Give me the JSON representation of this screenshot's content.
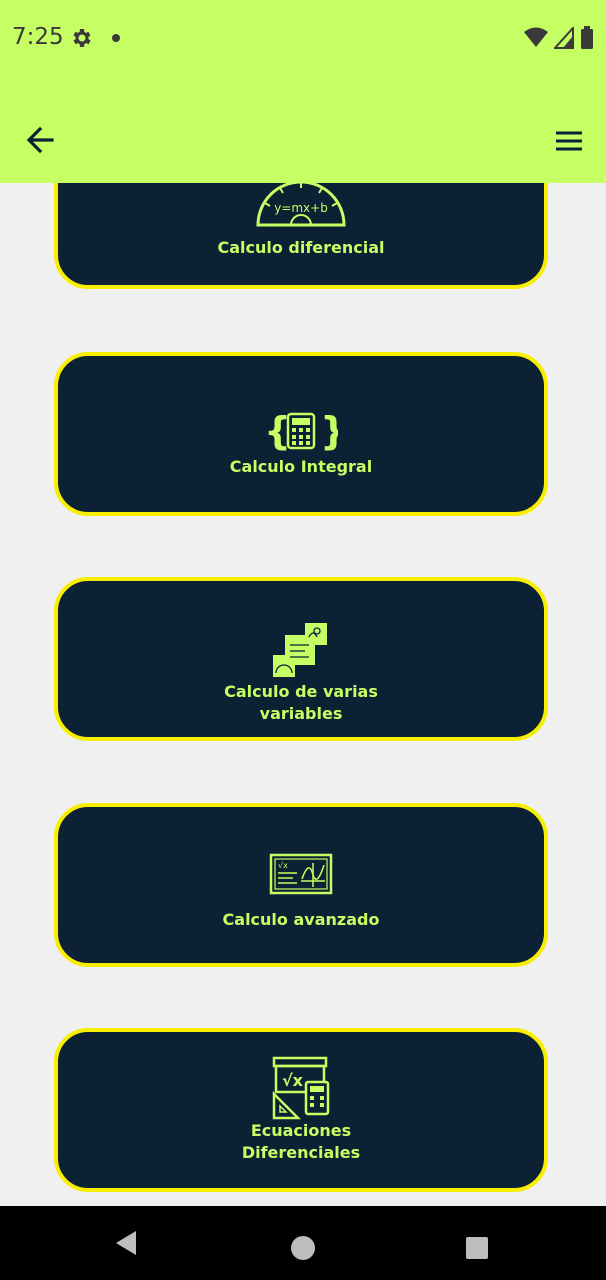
{
  "status_bar": {
    "time": "7:25",
    "icons": [
      "gear-icon",
      "notification-dot-icon",
      "wifi-icon",
      "signal-icon",
      "battery-icon"
    ]
  },
  "app_bar": {
    "back_icon": "arrow-back-icon",
    "menu_icon": "hamburger-menu-icon",
    "background": "#c5ff63"
  },
  "courses": [
    {
      "label": "Calculo diferencial",
      "icon": "protractor-equation-icon"
    },
    {
      "label": "Calculo Integral",
      "icon": "braces-calculator-icon"
    },
    {
      "label": "Calculo de varias\nvariables",
      "icon": "stacked-math-notes-icon"
    },
    {
      "label": "Calculo avanzado",
      "icon": "chalkboard-graph-icon"
    },
    {
      "label": "Ecuaciones\nDiferenciales",
      "icon": "board-calculator-ruler-icon"
    }
  ],
  "colors": {
    "card_background": "#0c2133",
    "card_border": "#f7ee00",
    "accent": "#c5ff63",
    "page_background": "#f0f0f0"
  },
  "nav_bar": {
    "icons": [
      "nav-back-icon",
      "nav-home-icon",
      "nav-recents-icon"
    ]
  }
}
